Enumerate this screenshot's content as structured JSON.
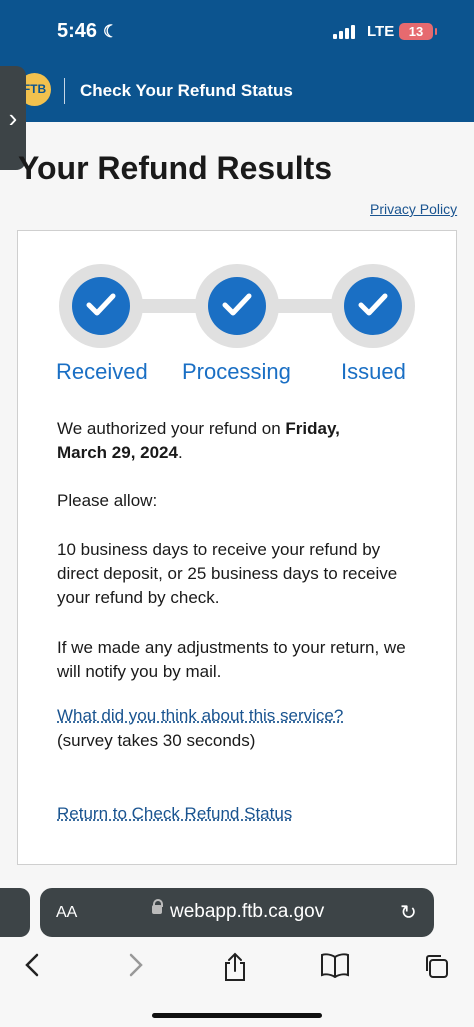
{
  "status_bar": {
    "time": "5:46",
    "network": "LTE",
    "battery": "13"
  },
  "header": {
    "logo_text": "FTB",
    "title": "Check Your Refund Status"
  },
  "page": {
    "heading": "Your Refund Results",
    "privacy_link": "Privacy Policy"
  },
  "progress": {
    "steps": [
      {
        "label": "Received"
      },
      {
        "label": "Processing"
      },
      {
        "label": "Issued"
      }
    ]
  },
  "message": {
    "authorized_prefix": "We authorized your refund on ",
    "authorized_date": "Friday, March 29, 2024",
    "authorized_suffix": ".",
    "please_allow": "Please allow:",
    "timing": "10 business days to receive your refund by direct deposit, or 25 business days to receive your refund by check.",
    "adjustments": "If we made any adjustments to your return, we will notify you by mail.",
    "survey_link": "What did you think about this service?",
    "survey_note": "(survey takes 30 seconds)",
    "return_link": "Return to Check Refund Status"
  },
  "browser": {
    "aa_label": "AA",
    "url": "webapp.ftb.ca.gov"
  },
  "colors": {
    "header_bg": "#0c548f",
    "step_blue": "#1a6fc4",
    "link": "#1a5490"
  }
}
